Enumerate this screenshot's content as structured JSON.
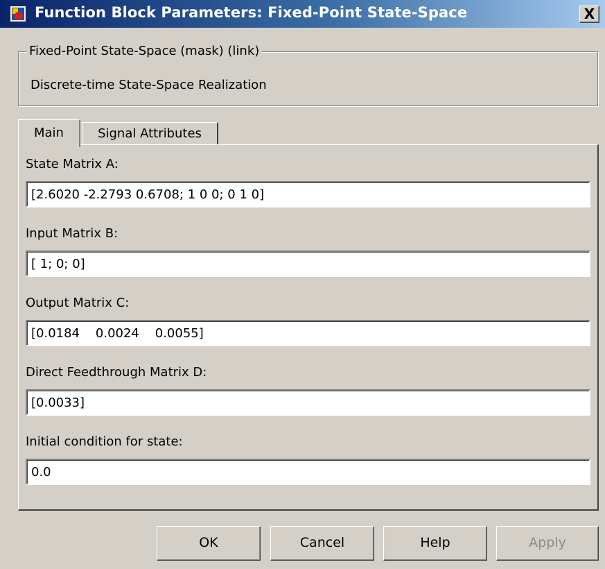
{
  "window": {
    "title": "Function Block Parameters: Fixed-Point State-Space",
    "close_label": "X"
  },
  "mask": {
    "legend": "Fixed-Point State-Space (mask) (link)",
    "description": "Discrete-time State-Space Realization"
  },
  "tabs": [
    {
      "label": "Main",
      "selected": true
    },
    {
      "label": "Signal Attributes",
      "selected": false
    }
  ],
  "fields": [
    {
      "label": "State Matrix A:",
      "value": "[2.6020 -2.2793 0.6708; 1 0 0; 0 1 0]"
    },
    {
      "label": "Input Matrix B:",
      "value": "[ 1; 0; 0]"
    },
    {
      "label": "Output Matrix C:",
      "value": "[0.0184    0.0024    0.0055]"
    },
    {
      "label": "Direct Feedthrough Matrix D:",
      "value": "[0.0033]"
    },
    {
      "label": "Initial condition for state:",
      "value": "0.0"
    }
  ],
  "buttons": {
    "ok": "OK",
    "cancel": "Cancel",
    "help": "Help",
    "apply": "Apply"
  },
  "colors": {
    "titlebar_start": "#0a246a",
    "titlebar_end": "#a6caf0",
    "face": "#d4d0c8",
    "disabled_text": "#8a8a8a"
  }
}
